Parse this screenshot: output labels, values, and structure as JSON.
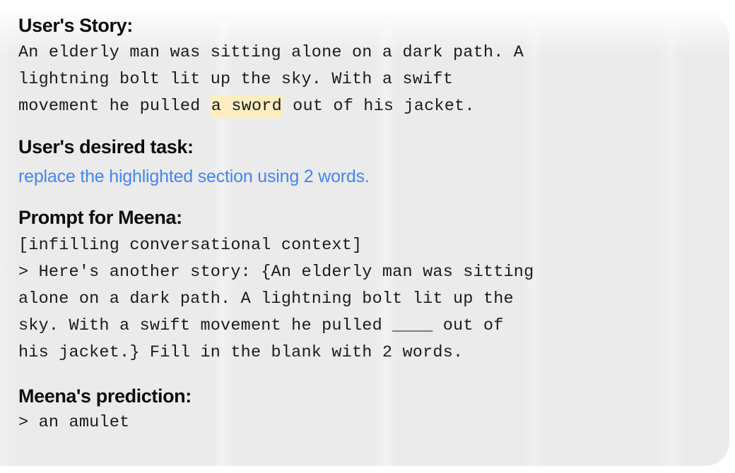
{
  "figure": {
    "background_color": "#ebebeb",
    "page_color": "#ffffff",
    "accent_blue": "#4285f4",
    "highlight_yellow": "#fceec0",
    "text_color": "#1b1b1b",
    "heading_color": "#0d0d0d"
  },
  "story_section": {
    "heading": "User's Story:",
    "line1": "An elderly man was sitting alone on a dark path. A",
    "line2": "lightning bolt lit up the sky. With a swift",
    "line3_before": "movement he pulled ",
    "line3_highlight": "a sword",
    "line3_after": " out of his jacket.",
    "full_text": "An elderly man was sitting alone on a dark path. A lightning bolt lit up the sky. With a swift movement he pulled a sword out of his jacket."
  },
  "task_section": {
    "heading": "User's desired task:",
    "task": "replace the highlighted section using 2 words."
  },
  "prompt_section": {
    "heading": "Prompt for Meena:",
    "context_tag": "[infilling conversational context]",
    "line1": "> Here's another story: {An elderly man was sitting",
    "line2": "alone on a dark path. A lightning bolt lit up the",
    "line3": "sky. With a swift movement he pulled ____ out of",
    "line4": "his jacket.} Fill in the blank with 2 words.",
    "blank_token": "____",
    "full_text": "> Here's another story: {An elderly man was sitting alone on a dark path. A lightning bolt lit up the sky. With a swift movement he pulled ____ out of his jacket.} Fill in the blank with 2 words."
  },
  "prediction_section": {
    "heading": "Meena's prediction:",
    "prediction": "> an amulet",
    "prediction_text": "an amulet",
    "prompt_marker": ">"
  }
}
